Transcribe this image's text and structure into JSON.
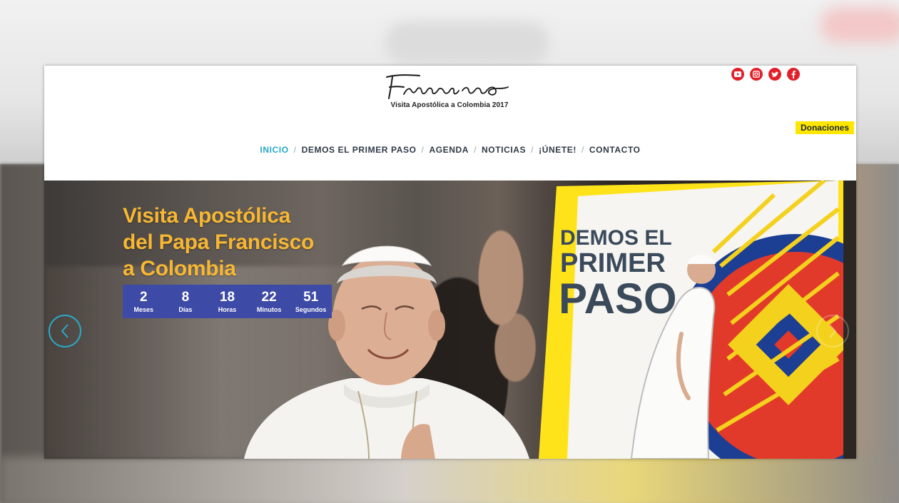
{
  "header": {
    "logo_script": "Francisco",
    "logo_subtitle": "Visita Apostólica a Colombia 2017",
    "donate_label": "Donaciones"
  },
  "social": [
    {
      "name": "youtube",
      "icon": "youtube-icon"
    },
    {
      "name": "instagram",
      "icon": "instagram-icon"
    },
    {
      "name": "twitter",
      "icon": "twitter-icon"
    },
    {
      "name": "facebook",
      "icon": "facebook-icon"
    }
  ],
  "nav": {
    "items": [
      {
        "label": "INICIO",
        "active": true
      },
      {
        "label": "DEMOS EL PRIMER PASO",
        "active": false
      },
      {
        "label": "AGENDA",
        "active": false
      },
      {
        "label": "NOTICIAS",
        "active": false
      },
      {
        "label": "¡ÚNETE!",
        "active": false
      },
      {
        "label": "CONTACTO",
        "active": false
      }
    ],
    "separator": "/"
  },
  "hero": {
    "title_line1": "Visita Apostólica",
    "title_line2": "del Papa Francisco",
    "title_line3": "a Colombia",
    "countdown": [
      {
        "value": "2",
        "label": "Meses"
      },
      {
        "value": "8",
        "label": "Días"
      },
      {
        "value": "18",
        "label": "Horas"
      },
      {
        "value": "22",
        "label": "Minutos"
      },
      {
        "value": "51",
        "label": "Segundos"
      }
    ],
    "poster_line1": "DEMOS EL",
    "poster_line2": "PRIMER",
    "poster_line3": "PASO"
  },
  "colors": {
    "accent": "#27a7c6",
    "title_yellow": "#f7b733",
    "countdown_bg": "#3d4aa6",
    "social_red": "#e2202b",
    "donate_yellow": "#ffe600"
  }
}
